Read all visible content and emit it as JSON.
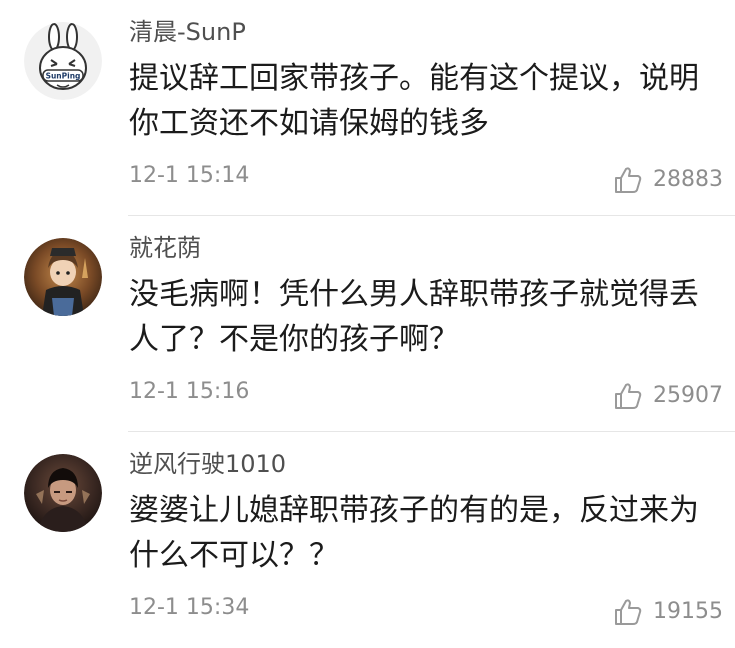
{
  "comments": [
    {
      "username": "清晨-SunP",
      "avatar": "sunping-rabbit-avatar",
      "avatar_text": "SunPing",
      "lines": [
        "提议辞工回家带孩子。能有这个提议，说明",
        "你工资还不如请保姆的钱多"
      ],
      "timestamp": "12-1 15:14",
      "likes": "28883",
      "like_icon": "thumbs-up-icon"
    },
    {
      "username": "就花荫",
      "avatar": "anime-character-avatar",
      "lines": [
        "没毛病啊！凭什么男人辞职带孩子就觉得丢",
        "人了？不是你的孩子啊？"
      ],
      "timestamp": "12-1 15:16",
      "likes": "25907",
      "like_icon": "thumbs-up-icon"
    },
    {
      "username": "逆风行驶1010",
      "avatar": "dark-portrait-avatar",
      "lines": [
        "婆婆让儿媳辞职带孩子的有的是，反过来为",
        "什么不可以？？"
      ],
      "timestamp": "12-1 15:34",
      "likes": "19155",
      "like_icon": "thumbs-up-icon"
    }
  ]
}
